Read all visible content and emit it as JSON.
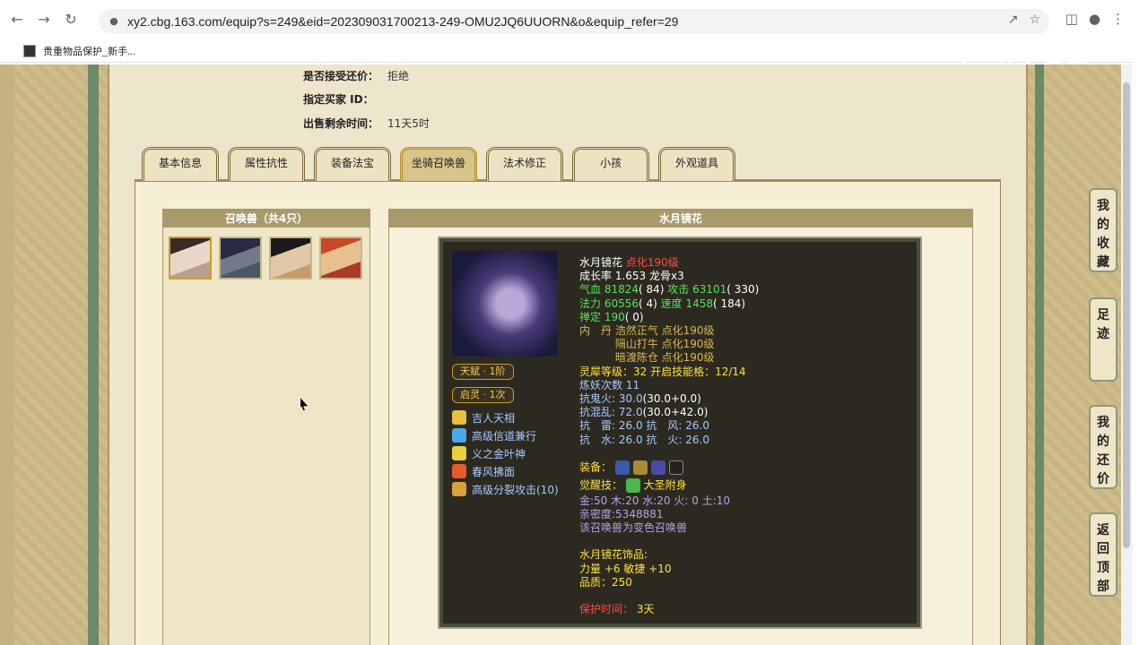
{
  "browser": {
    "url": "xy2.cbg.163.com/equip?s=249&eid=202309031700213-249-OMU2JQ6UUORN&o&equip_refer=29",
    "bookmark": "贵重物品保护_新手..."
  },
  "watermark": "CC直播",
  "info": {
    "accept_counter_label": "是否接受还价：",
    "accept_counter_value": "拒绝",
    "buyer_id_label": "指定买家 ID：",
    "buyer_id_value": "",
    "remaining_label": "出售剩余时间：",
    "remaining_value": "11天5时"
  },
  "tabs": [
    {
      "label": "基本信息"
    },
    {
      "label": "属性抗性"
    },
    {
      "label": "装备法宝"
    },
    {
      "label": "坐骑召唤兽"
    },
    {
      "label": "法术修正"
    },
    {
      "label": "小孩"
    },
    {
      "label": "外观道具"
    }
  ],
  "active_tab": 3,
  "pets_panel": {
    "title": "召唤兽（共4只）"
  },
  "detail_panel": {
    "title": "水月镜花"
  },
  "pet": {
    "name": "水月镜花",
    "level_tag": "点化190级",
    "growth": "成长率 1.653 龙骨x3",
    "hp_line_a": "气血 81824",
    "hp_line_b": "( 84)",
    "atk_a": " 攻击 63101",
    "atk_b": "( 330)",
    "mp_a": "法力 60556",
    "mp_b": "( 4)",
    "spd_a": " 速度 1458",
    "spd_b": "( 184)",
    "zen_a": "禅定 190",
    "zen_b": "( 0)",
    "inner_1": "内　丹 浩然正气 点化190级",
    "inner_2": "　　　 隔山打牛 点化190级",
    "inner_3": "　　　 暗渡陈仓 点化190级",
    "spirit": "灵犀等级：32 开启技能格：12/14",
    "refine": "炼妖次数 11",
    "res_ghost_a": "抗鬼火: 30.0",
    "res_ghost_b": "(30.0+0.0)",
    "res_chaos_a": "抗混乱: 72.0",
    "res_chaos_b": "(30.0+42.0)",
    "res_thunder": "抗　雷: 26.0 抗　风: 26.0",
    "res_water": "抗　水: 26.0 抗　火: 26.0",
    "equip_label": "装备：",
    "awaken_label": "觉醒技：",
    "awaken_value": "大圣附身",
    "elements": "金:50 木:20 水:20 火: 0 土:10",
    "intimacy": "亲密度:5348881",
    "variant": "该召唤兽为变色召唤兽",
    "ornament_title": "水月镜花饰品:",
    "ornament_stats": "力量 +6 敏捷 +10",
    "ornament_quality": "品质：250",
    "protect_label": "保护时间：",
    "protect_value": "3天",
    "badge_talent": "天赋 · 1阶",
    "badge_spirit": "启灵 · 1次",
    "skills": [
      {
        "name": "吉人天相",
        "icon": "lucky-icon",
        "color": "#e8c040"
      },
      {
        "name": "高级信道兼行",
        "icon": "wind-icon",
        "color": "#4aa8e8"
      },
      {
        "name": "义之金叶神",
        "icon": "gold-leaf-icon",
        "color": "#e8d040"
      },
      {
        "name": "春风拂面",
        "icon": "fire-icon",
        "color": "#e85a2a"
      },
      {
        "name": "高级分裂攻击(10)",
        "icon": "split-icon",
        "color": "#d8a040"
      }
    ]
  },
  "side_buttons": [
    {
      "label": "我的收藏"
    },
    {
      "label": "足迹"
    },
    {
      "label": "我的还价"
    },
    {
      "label": "返回顶部"
    }
  ],
  "colors": {
    "accent": "#a89a6a",
    "dark_box": "#2c2a20",
    "skill_text": "#a8c8ff"
  }
}
